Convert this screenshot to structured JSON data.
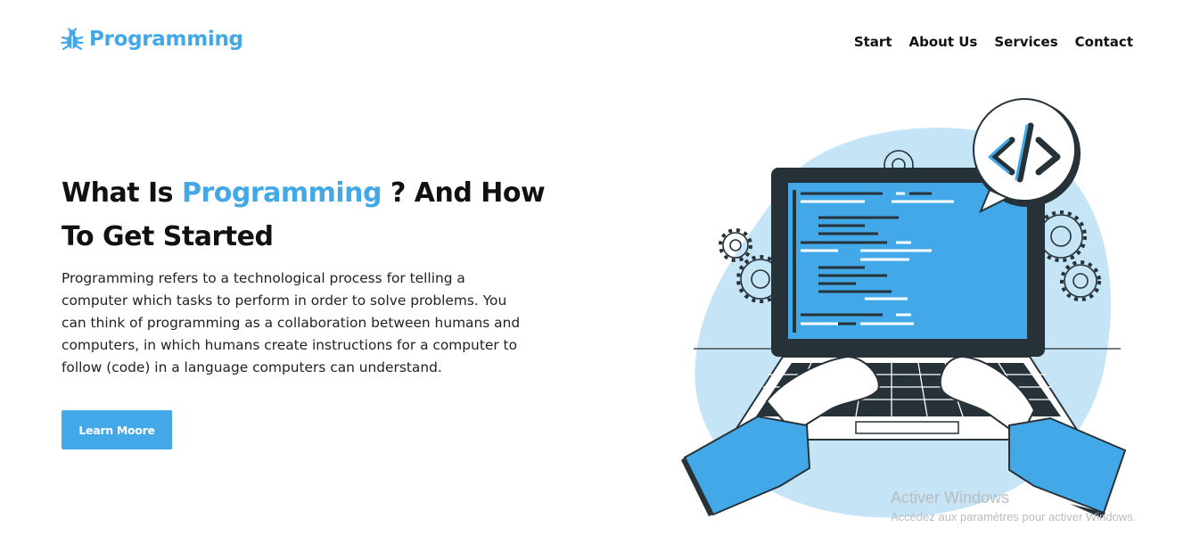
{
  "brand": {
    "name": "Programming",
    "icon": "bug-icon",
    "color": "#42a8e8"
  },
  "nav": {
    "items": [
      {
        "label": "Start"
      },
      {
        "label": "About Us"
      },
      {
        "label": "Services"
      },
      {
        "label": "Contact"
      }
    ]
  },
  "hero": {
    "title_before": "What Is ",
    "title_accent": "Programming",
    "title_after": " ? And How To Get Started",
    "description": "Programming refers to a technological process for telling a computer which tasks to perform in order to solve problems. You can think of programming as a collaboration between humans and computers, in which humans create instructions for a computer to follow (code) in a language computers can understand.",
    "cta_label": "Learn Moore"
  },
  "illustration": {
    "subject": "laptop-coding-illustration",
    "code_bubble_text": "</>"
  },
  "watermark": {
    "title": "Activer Windows",
    "subtitle": "Accédez aux paramètres pour activer Windows."
  },
  "colors": {
    "accent": "#42a8e8",
    "dark": "#263238",
    "light_blue": "#c5e5f7"
  }
}
